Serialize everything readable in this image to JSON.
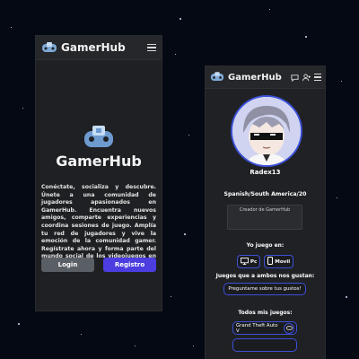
{
  "app": {
    "brand": "GamerHub"
  },
  "colors": {
    "accent": "#4b3de0",
    "border_accent": "#3c50d8",
    "panel_bg": "#1f2023",
    "bar_bg": "#26272b"
  },
  "landing": {
    "hero_title": "GamerHub",
    "description": "Conéctate, socializa y descubre. Únete a una comunidad de jugadores apasionados en GamerHub. Encuentra nuevos amigos, comparte experiencias y coordina sesiones de juego. Amplía tu red de jugadores y vive la emoción de la comunidad gamer. Regístrate ahora y forma parte del mundo social de los videojuegos en GamerHub.",
    "login_label": "Login",
    "register_label": "Registro"
  },
  "profile": {
    "username": "Radex13",
    "region": "Spanish/South America/20",
    "bio": "Creador de GamerHub",
    "plays_on_label": "Yo juego en:",
    "platforms": [
      {
        "label": "Pc",
        "icon": "monitor-icon"
      },
      {
        "label": "Movil",
        "icon": "phone-icon"
      }
    ],
    "common_games_label": "Juegos que a ambos nos gustan:",
    "ask_label": "Preguntame sobre tus gustos!",
    "all_games_label": "Todos mis juegos:",
    "games": [
      {
        "name": "Grand Theft Auto V",
        "icon": "gamepad-icon"
      }
    ]
  },
  "icons": {
    "menu": "hamburger-icon",
    "chat": "chat-icon",
    "friends": "users-icon",
    "logo": "gamepad-logo-icon"
  }
}
